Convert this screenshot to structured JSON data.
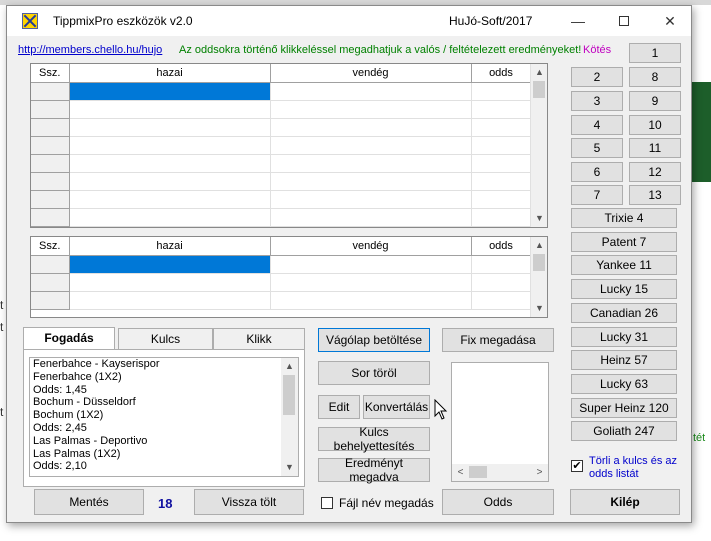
{
  "window": {
    "title": "TippmixPro eszközök  v2.0",
    "brand": "HuJó-Soft/2017",
    "controls": {
      "min": "—",
      "close": "✕"
    }
  },
  "header": {
    "link": "http://members.chello.hu/hujo",
    "instruction": "Az oddsokra történő klikkeléssel megadhatjuk a valós /  feltételezett eredményeket!",
    "kotes": "Kötés"
  },
  "grid_top": {
    "columns": [
      "Ssz.",
      "hazai",
      "vendég",
      "odds"
    ],
    "rows": 8
  },
  "grid_bottom": {
    "columns": [
      "Ssz.",
      "hazai",
      "vendég",
      "odds"
    ],
    "rows": 3
  },
  "tabs": [
    "Fogadás",
    "Kulcs",
    "Klikk"
  ],
  "list_items": [
    "Fenerbahce - Kayserispor",
    "Fenerbahce (1X2)",
    "Odds: 1,45",
    "Bochum - Düsseldorf",
    "Bochum (1X2)",
    "Odds: 2,45",
    "Las Palmas - Deportivo",
    "Las Palmas (1X2)",
    "Odds: 2,10"
  ],
  "buttons": {
    "vagolap": "Vágólap betöltése",
    "fix": "Fix megadása",
    "sortorol": "Sor töröl",
    "edit": "Edit",
    "konvertalas": "Konvertálás",
    "kulcs": "Kulcs behelyettesítés",
    "eredmeny": "Eredményt megadva",
    "mentes": "Mentés",
    "visszatolt": "Vissza tölt",
    "odds": "Odds",
    "kilep": "Kilép"
  },
  "count": "18",
  "fajlnev_label": "Fájl név megadás",
  "torli_label": "Törli a kulcs és az odds listát",
  "number_buttons": [
    "1",
    "2",
    "8",
    "3",
    "9",
    "4",
    "10",
    "5",
    "11",
    "6",
    "12",
    "7",
    "13"
  ],
  "system_buttons": [
    "Trixie 4",
    "Patent 7",
    "Yankee 11",
    "Lucky 15",
    "Canadian 26",
    "Lucky 31",
    "Heinz 57",
    "Lucky 63",
    "Super Heinz 120",
    "Goliath 247"
  ],
  "background": {
    "left_text": "t",
    "right_text": "tét"
  }
}
